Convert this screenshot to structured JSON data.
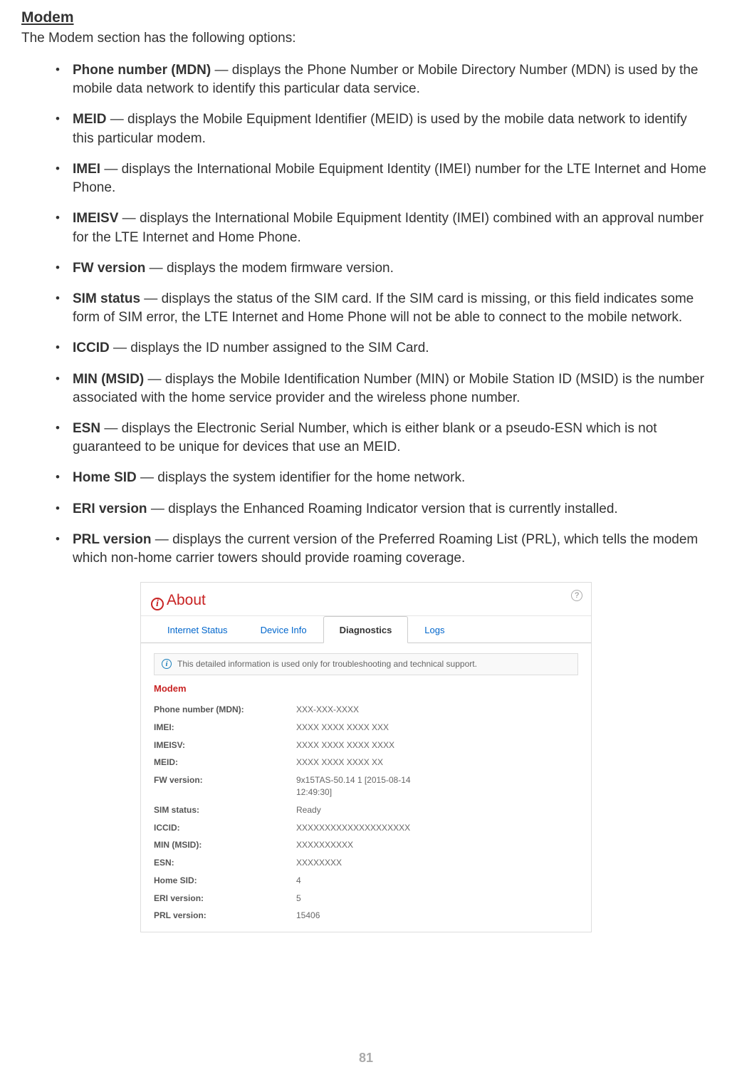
{
  "heading": "Modem",
  "intro": "The Modem section has the following options:",
  "items": [
    {
      "term": "Phone number (MDN)",
      "desc": " — displays the Phone Number or Mobile Directory Number (MDN) is used by the mobile data network to identify this particular data service."
    },
    {
      "term": "MEID",
      "desc": " — displays the Mobile Equipment Identifier (MEID) is used by the mobile data network to identify this particular modem."
    },
    {
      "term": "IMEI",
      "desc": " — displays the International Mobile Equipment Identity (IMEI) number for the LTE Internet and Home Phone."
    },
    {
      "term": "IMEISV",
      "desc": " — displays the International Mobile Equipment Identity (IMEI) combined with an approval number for the LTE Internet and Home Phone."
    },
    {
      "term": "FW version",
      "desc": " — displays the modem firmware version."
    },
    {
      "term": "SIM status",
      "desc": " — displays the status of the SIM card. If the SIM card is missing, or this field indicates some form of SIM error, the  LTE Internet and Home Phone will not be able to connect to the mobile network."
    },
    {
      "term": "ICCID",
      "desc": " — displays the ID number assigned to the SIM Card."
    },
    {
      "term": "MIN (MSID)",
      "desc": " — displays the Mobile Identification Number (MIN) or Mobile Station ID (MSID) is the number associated with the home service provider and the wireless phone number."
    },
    {
      "term": "ESN",
      "desc": " — displays the Electronic Serial Number, which is either blank or a pseudo-ESN which is not guaranteed to be unique for devices that use an MEID."
    },
    {
      "term": "Home SID",
      "desc": " — displays the system identifier for the home network."
    },
    {
      "term": "ERI version",
      "desc": " — displays the Enhanced Roaming Indicator version that is currently installed."
    },
    {
      "term": "PRL version",
      "desc": " — displays the current version of the Preferred Roaming List (PRL), which tells the modem which non-home carrier towers should provide roaming coverage."
    }
  ],
  "screenshot": {
    "aboutTitle": "About",
    "helpGlyph": "?",
    "infoGlyph": "i",
    "tabs": {
      "internetStatus": "Internet Status",
      "deviceInfo": "Device Info",
      "diagnostics": "Diagnostics",
      "logs": "Logs"
    },
    "banner": "This detailed information is used only for troubleshooting and technical support.",
    "sectionTitle": "Modem",
    "fields": [
      {
        "label": "Phone number (MDN):",
        "value": "XXX-XXX-XXXX"
      },
      {
        "label": "IMEI:",
        "value": "XXXX XXXX XXXX XXX"
      },
      {
        "label": "IMEISV:",
        "value": "XXXX XXXX XXXX XXXX"
      },
      {
        "label": "MEID:",
        "value": "XXXX XXXX XXXX XX"
      },
      {
        "label": "FW version:",
        "value": "9x15TAS-50.14 1 [2015-08-14 12:49:30]"
      },
      {
        "label": "SIM status:",
        "value": "Ready"
      },
      {
        "label": "ICCID:",
        "value": "XXXXXXXXXXXXXXXXXXXX"
      },
      {
        "label": "MIN (MSID):",
        "value": "XXXXXXXXXX"
      },
      {
        "label": "ESN:",
        "value": "XXXXXXXX"
      },
      {
        "label": "Home SID:",
        "value": "4"
      },
      {
        "label": "ERI version:",
        "value": "5"
      },
      {
        "label": "PRL version:",
        "value": "15406"
      }
    ]
  },
  "pageNumber": "81"
}
